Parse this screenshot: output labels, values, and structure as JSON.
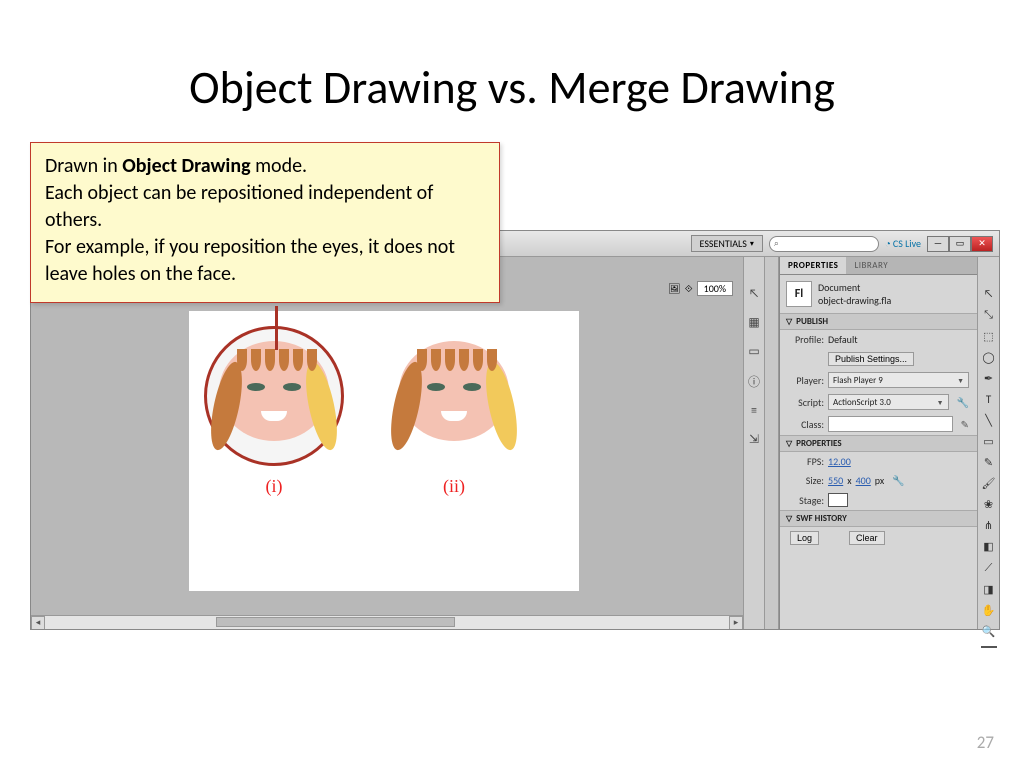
{
  "slide": {
    "title": "Object Drawing vs. Merge Drawing",
    "page_number": "27"
  },
  "callout": {
    "line1_pre": "Drawn in ",
    "line1_bold": "Object Drawing",
    "line1_post": " mode.",
    "line2": "Each object can be repositioned independent of others.",
    "line3": "For example, if you reposition the eyes, it does not leave holes on the face."
  },
  "canvas": {
    "zoom_value": "100%",
    "label_i": "(i)",
    "label_ii": "(ii)"
  },
  "topbar": {
    "workspace": "ESSENTIALS",
    "cslive": "CS Live",
    "min": "—",
    "max": "▭",
    "close": "✕"
  },
  "properties": {
    "tab_properties": "PROPERTIES",
    "tab_library": "LIBRARY",
    "doc_type": "Document",
    "doc_name": "object-drawing.fla",
    "doc_icon": "Fl",
    "section_publish": "PUBLISH",
    "profile_label": "Profile:",
    "profile_value": "Default",
    "publish_settings_btn": "Publish Settings...",
    "player_label": "Player:",
    "player_value": "Flash Player 9",
    "script_label": "Script:",
    "script_value": "ActionScript 3.0",
    "class_label": "Class:",
    "section_properties": "PROPERTIES",
    "fps_label": "FPS:",
    "fps_value": "12.00",
    "size_label": "Size:",
    "size_w": "550",
    "size_x": "x",
    "size_h": "400",
    "size_unit": "px",
    "stage_label": "Stage:",
    "section_swf": "SWF HISTORY",
    "swf_log": "Log",
    "swf_clear": "Clear"
  }
}
